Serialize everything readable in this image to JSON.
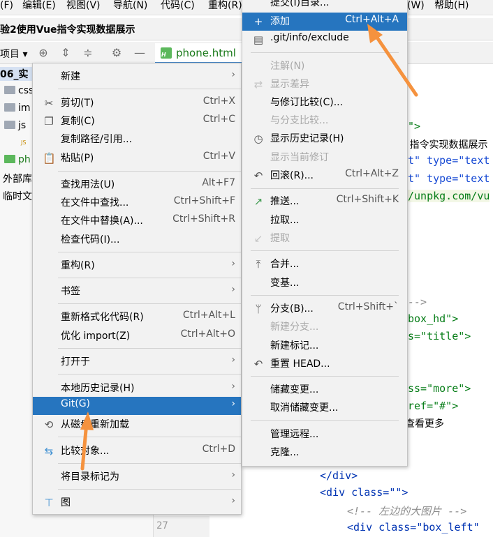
{
  "menubar": {
    "items": [
      "(F)",
      "编辑(E)",
      "视图(V)",
      "导航(N)",
      "代码(C)",
      "重构(R)",
      "(W)",
      "帮助(H)"
    ]
  },
  "titlebar": {
    "title": "验2使用Vue指令实现数据展示"
  },
  "toolbar": {
    "project_label": "项目",
    "icons": [
      "locate-icon",
      "expand-all-icon",
      "collapse-all-icon",
      "gear-icon",
      "minimize-icon"
    ]
  },
  "editor_tab": {
    "filename": "phone.html"
  },
  "tree": {
    "rows": [
      {
        "label": "06_实"
      },
      {
        "label": "css"
      },
      {
        "label": "im"
      },
      {
        "label": "js"
      },
      {
        "label": "JS"
      },
      {
        "label": "ph"
      },
      {
        "label": "外部库"
      },
      {
        "label": "临时文"
      }
    ]
  },
  "code": {
    "lines": [
      {
        "parts": [
          "\">"
        ]
      },
      {
        "parts": [
          " 指令实现数据展示"
        ]
      },
      {
        "parts": [
          "t\" type=\"text"
        ]
      },
      {
        "parts": [
          "t\" type=\"text"
        ]
      },
      {
        "parts": [
          "/unpkg.com/vu"
        ]
      },
      {
        "parts": [
          "-->"
        ]
      },
      {
        "parts": [
          "box_hd\">"
        ]
      },
      {
        "parts": [
          "s=\"title\">"
        ]
      },
      {
        "parts": [
          "ss=\"more\">"
        ]
      },
      {
        "parts": [
          "ref=\"#\">"
        ]
      },
      {
        "parts": [
          "查看更多"
        ]
      },
      {
        "parts": [
          "</div>"
        ]
      },
      {
        "parts": [
          "<div class=\"\">"
        ]
      },
      {
        "parts": [
          "<!-- 左边的大图片 -->"
        ]
      },
      {
        "parts": [
          "<div class=\"box_left\""
        ]
      }
    ],
    "line_number": "27"
  },
  "context_menu": {
    "items": [
      {
        "label": "新建",
        "shortcut": "",
        "submenu": true,
        "icon": ""
      },
      {
        "label": "剪切(T)",
        "shortcut": "Ctrl+X",
        "submenu": false,
        "icon": "scissors-icon"
      },
      {
        "label": "复制(C)",
        "shortcut": "Ctrl+C",
        "submenu": false,
        "icon": "copy-icon"
      },
      {
        "label": "复制路径/引用...",
        "shortcut": "",
        "submenu": false,
        "icon": ""
      },
      {
        "label": "粘贴(P)",
        "shortcut": "Ctrl+V",
        "submenu": false,
        "icon": "paste-icon"
      },
      {
        "label": "查找用法(U)",
        "shortcut": "Alt+F7",
        "submenu": false,
        "icon": ""
      },
      {
        "label": "在文件中查找...",
        "shortcut": "Ctrl+Shift+F",
        "submenu": false,
        "icon": ""
      },
      {
        "label": "在文件中替换(A)...",
        "shortcut": "Ctrl+Shift+R",
        "submenu": false,
        "icon": ""
      },
      {
        "label": "检查代码(I)...",
        "shortcut": "",
        "submenu": false,
        "icon": ""
      },
      {
        "label": "重构(R)",
        "shortcut": "",
        "submenu": true,
        "icon": ""
      },
      {
        "label": "书签",
        "shortcut": "",
        "submenu": true,
        "icon": ""
      },
      {
        "label": "重新格式化代码(R)",
        "shortcut": "Ctrl+Alt+L",
        "submenu": false,
        "icon": ""
      },
      {
        "label": "优化 import(Z)",
        "shortcut": "Ctrl+Alt+O",
        "submenu": false,
        "icon": ""
      },
      {
        "label": "打开于",
        "shortcut": "",
        "submenu": true,
        "icon": ""
      },
      {
        "label": "本地历史记录(H)",
        "shortcut": "",
        "submenu": true,
        "icon": ""
      },
      {
        "label": "Git(G)",
        "shortcut": "",
        "submenu": true,
        "icon": "",
        "highlighted": true
      },
      {
        "label": "从磁盘重新加载",
        "shortcut": "",
        "submenu": false,
        "icon": "reload-icon"
      },
      {
        "label": "比较对象...",
        "shortcut": "Ctrl+D",
        "submenu": false,
        "icon": "compare-icon"
      },
      {
        "label": "将目录标记为",
        "shortcut": "",
        "submenu": true,
        "icon": ""
      },
      {
        "label": "图",
        "shortcut": "",
        "submenu": true,
        "icon": "diagram-icon"
      }
    ]
  },
  "git_menu": {
    "items": [
      {
        "label": "提交(I)目录...",
        "shortcut": "",
        "disabled": false,
        "icon": ""
      },
      {
        "label": "添加",
        "shortcut": "Ctrl+Alt+A",
        "disabled": false,
        "icon": "plus-icon",
        "highlighted": true
      },
      {
        "label": ".git/info/exclude",
        "shortcut": "",
        "disabled": false,
        "icon": "file-icon"
      },
      {
        "label": "注解(N)",
        "shortcut": "",
        "disabled": true,
        "icon": ""
      },
      {
        "label": "显示差异",
        "shortcut": "",
        "disabled": true,
        "icon": "diff-icon"
      },
      {
        "label": "与修订比较(C)...",
        "shortcut": "",
        "disabled": false,
        "icon": ""
      },
      {
        "label": "与分支比较...",
        "shortcut": "",
        "disabled": true,
        "icon": ""
      },
      {
        "label": "显示历史记录(H)",
        "shortcut": "",
        "disabled": false,
        "icon": "clock-icon"
      },
      {
        "label": "显示当前修订",
        "shortcut": "",
        "disabled": true,
        "icon": ""
      },
      {
        "label": "回滚(R)...",
        "shortcut": "Ctrl+Alt+Z",
        "disabled": false,
        "icon": "undo-icon"
      },
      {
        "label": "推送...",
        "shortcut": "Ctrl+Shift+K",
        "disabled": false,
        "icon": "push-icon"
      },
      {
        "label": "拉取...",
        "shortcut": "",
        "disabled": false,
        "icon": ""
      },
      {
        "label": "提取",
        "shortcut": "",
        "disabled": true,
        "icon": "fetch-icon"
      },
      {
        "label": "合并...",
        "shortcut": "",
        "disabled": false,
        "icon": "merge-icon"
      },
      {
        "label": "变基...",
        "shortcut": "",
        "disabled": false,
        "icon": ""
      },
      {
        "label": "分支(B)...",
        "shortcut": "Ctrl+Shift+`",
        "disabled": false,
        "icon": "branch-icon"
      },
      {
        "label": "新建分支...",
        "shortcut": "",
        "disabled": true,
        "icon": ""
      },
      {
        "label": "新建标记...",
        "shortcut": "",
        "disabled": false,
        "icon": ""
      },
      {
        "label": "重置 HEAD...",
        "shortcut": "",
        "disabled": false,
        "icon": "reset-icon"
      },
      {
        "label": "储藏变更...",
        "shortcut": "",
        "disabled": false,
        "icon": ""
      },
      {
        "label": "取消储藏变更...",
        "shortcut": "",
        "disabled": false,
        "icon": ""
      },
      {
        "label": "管理远程...",
        "shortcut": "",
        "disabled": false,
        "icon": ""
      },
      {
        "label": "克隆...",
        "shortcut": "",
        "disabled": false,
        "icon": ""
      }
    ]
  },
  "annotation": {
    "arrow_color": "#f5923e"
  },
  "colors": {
    "highlight": "#2675bf",
    "menu_bg": "#f2f2f2",
    "disabled_text": "#a8a8a8"
  }
}
